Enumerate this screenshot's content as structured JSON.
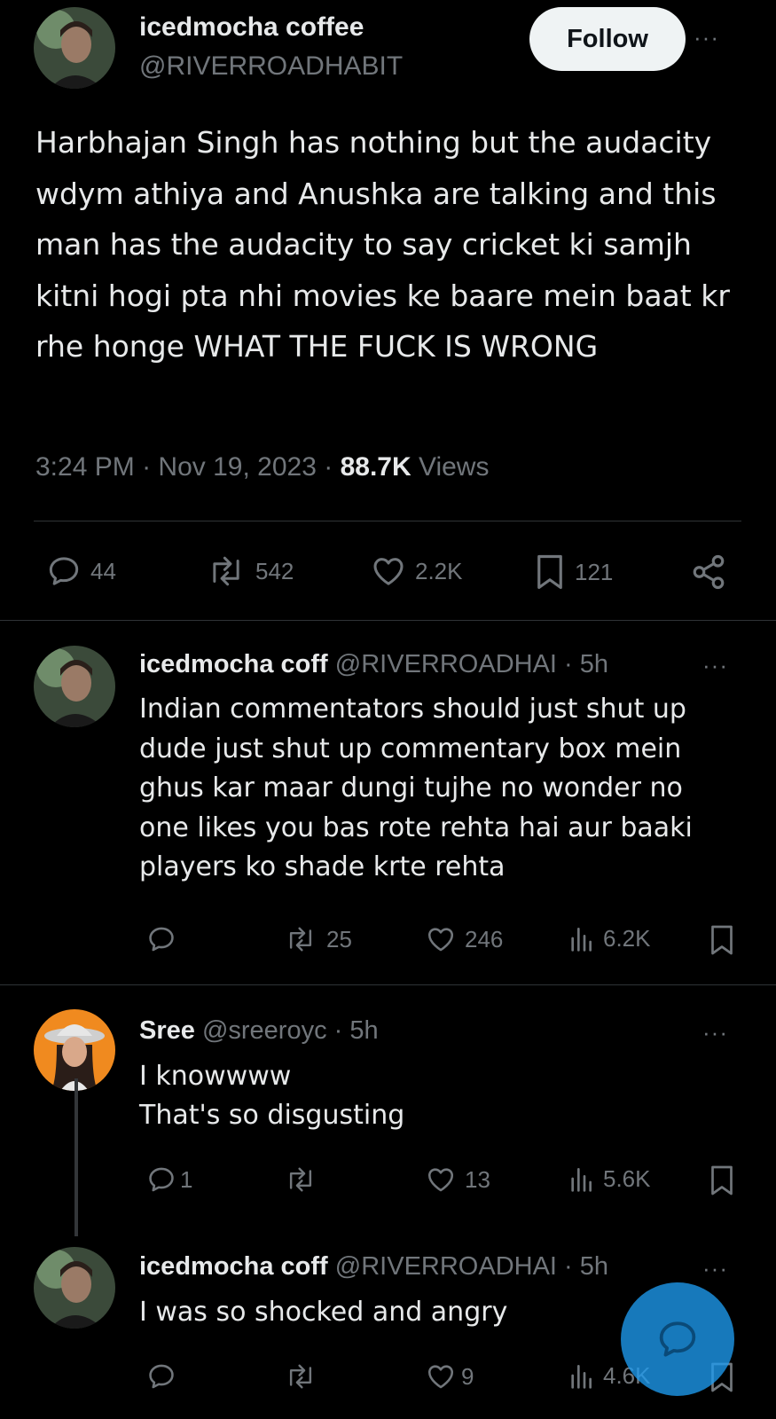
{
  "main_tweet": {
    "display_name": "icedmocha coffee",
    "handle": "@RIVERROADHABIT",
    "follow_label": "Follow",
    "text": "Harbhajan Singh has nothing but the audacity wdym athiya and Anushka are talking and this man has the audacity to say cricket ki samjh kitni hogi pta nhi movies ke baare mein baat kr rhe honge WHAT THE FUCK IS WRONG",
    "time": "3:24 PM",
    "dot1": "·",
    "date": "Nov 19, 2023",
    "dot2": "·",
    "views_count": "88.7K",
    "views_label": "Views",
    "stats": {
      "replies": "44",
      "reposts": "542",
      "likes": "2.2K",
      "bookmarks": "121"
    }
  },
  "replies": [
    {
      "display_name": "icedmocha coff",
      "handle": "@RIVERROADHAI",
      "dot": "·",
      "age": "5h",
      "text": "Indian commentators should just shut up dude just shut up commentary box mein ghus kar maar dungi tujhe no wonder no one likes you bas rote rehta hai aur baaki players ko shade krte rehta",
      "reposts": "25",
      "likes": "246",
      "views": "6.2K"
    },
    {
      "display_name": "Sree",
      "handle": "@sreeroyc",
      "dot": "·",
      "age": "5h",
      "line1": "I knowwww",
      "line2": "That's so disgusting",
      "replies": "1",
      "likes": "13",
      "views": "5.6K"
    },
    {
      "display_name": "icedmocha coff",
      "handle": "@RIVERROADHAI",
      "dot": "·",
      "age": "5h",
      "text": "I was so shocked and angry",
      "likes": "9",
      "views": "4.6K"
    }
  ],
  "more_glyph": "···",
  "icons": [
    "more-icon",
    "reply-icon",
    "repost-icon",
    "like-icon",
    "bookmark-icon",
    "share-icon",
    "views-icon",
    "compose-icon"
  ],
  "colors": {
    "background": "#000000",
    "text": "#e7e9ea",
    "secondary": "#71767b",
    "accent": "#1d9bf0",
    "follow_bg": "#eff3f4"
  }
}
